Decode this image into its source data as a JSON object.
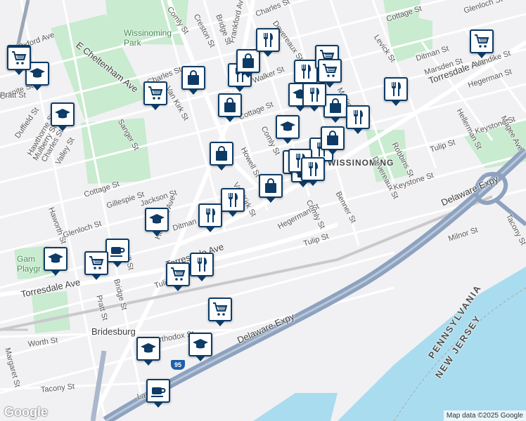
{
  "colors": {
    "background": "#f1f1f3",
    "park": "#c9ebd0",
    "water": "#a9dcef",
    "highway": "#8da2bf",
    "road": "#ffffff",
    "pin_border": "#0d3b66"
  },
  "labels": {
    "wissinoming_park": "Wissinoming\nPark",
    "gambrel_playground": "Gam\nPlaygr",
    "neighborhood": "WISSINOMING",
    "bridesburg": "Bridesburg",
    "pennsylvania": "PENNSYLVANIA",
    "new_jersey": "NEW JERSEY",
    "streets": {
      "oxford_ave": "Oxford Ave",
      "e_cheltenham_ave": "E Cheltenham Ave",
      "comly_st_top": "Comly St",
      "creston_st": "Creston St",
      "bridge_st_top": "Bridge St",
      "charles_st_top": "Charles St",
      "devereaux_st_top": "Devereaux St",
      "levick_st": "Levick St",
      "cottage_st_top": "Cottage St",
      "glenloch_st_top": "Glenloch St",
      "frankford_ave_top": "Frankford Ave",
      "marsden_st": "Marsden St",
      "ditman_st_top": "Ditman St",
      "torresdale_ave_right": "Torresdale Ave",
      "vandike_st": "Vandike St",
      "hegerman_st_right": "Hegerman St",
      "hellerman_st": "Hellerman St",
      "keystone_st_right": "Keystone St",
      "magee_ave": "Magee Ave",
      "tulip_st_right": "Tulip St",
      "robbins_st": "Robbins St",
      "devereaux_st_mid": "Devereaux St",
      "benner_st": "Benner St",
      "keystone_st_mid": "Keystone St",
      "delaware_expy_right": "Delaware Expy",
      "tacony_st_right": "Tacony St",
      "milnor_st": "Milnor St",
      "granite_st": "Granite St",
      "pratt_st_left": "Pratt St",
      "duffield_st": "Duffield St",
      "hawthorne_st": "Hawthorne St",
      "mulberry_st": "Mulberry St",
      "charles_st_left": "Charles St",
      "valley_st": "Valley St",
      "haworth_st": "Haworth St",
      "sanger_st": "Sanger St",
      "van_kirk_st_top": "Van Kirk St",
      "charles_st_mid": "Charles St",
      "cottage_st_mid": "Cottage St",
      "walker_st": "Walker St",
      "comly_st_mid": "Comly St",
      "howell_st": "Howell St",
      "van_kirk_st_mid": "Van Kirk St",
      "mckinley_st": "McKinley St",
      "cottage_st_left": "Cottage St",
      "gillespie_st": "Gillespie St",
      "jackson_st": "Jackson St",
      "ditman_st_left": "Ditman St",
      "glenloch_st_left": "Glenloch St",
      "brill_st": "Brill St",
      "harbison_ave": "Harbison Ave",
      "torresdale_ave_mid": "Torresdale Ave",
      "hegerman_st_mid": "Hegerman St",
      "comly_st_low": "Comly St",
      "tulip_st_mid": "Tulip St",
      "tulip_st_left": "Tulip St",
      "torresdale_ave_left": "Torresdale Ave",
      "pratt_st_low": "Pratt St",
      "bridge_st_low": "Bridge St",
      "margaret_st": "Margaret St",
      "worth_st": "Worth St",
      "orthodox_st": "Orthodox St",
      "delaware_expy_low": "Delaware Expy",
      "tacony_st_low": "Tacony St",
      "larue_st": "Larue St"
    },
    "shields": {
      "i95_low": "95"
    }
  },
  "pins": [
    {
      "type": "shopping-cart",
      "label": "grocery"
    },
    {
      "type": "graduation-cap",
      "label": "school"
    },
    {
      "type": "graduation-cap",
      "label": "school"
    },
    {
      "type": "shopping-cart",
      "label": "grocery"
    },
    {
      "type": "shopping-bag",
      "label": "store"
    },
    {
      "type": "fork-knife",
      "label": "restaurant"
    },
    {
      "type": "shopping-bag",
      "label": "store"
    },
    {
      "type": "fork-knife",
      "label": "restaurant"
    },
    {
      "type": "shopping-bag",
      "label": "store"
    },
    {
      "type": "fork-knife",
      "label": "restaurant"
    },
    {
      "type": "shopping-cart",
      "label": "grocery"
    },
    {
      "type": "fork-knife",
      "label": "restaurant"
    },
    {
      "type": "graduation-cap",
      "label": "school"
    },
    {
      "type": "shopping-bag",
      "label": "store"
    },
    {
      "type": "fork-knife",
      "label": "restaurant"
    },
    {
      "type": "fork-knife",
      "label": "restaurant"
    },
    {
      "type": "shopping-cart",
      "label": "grocery"
    },
    {
      "type": "graduation-cap",
      "label": "school"
    },
    {
      "type": "shopping-bag",
      "label": "store"
    },
    {
      "type": "fork-knife",
      "label": "restaurant"
    },
    {
      "type": "fork-knife",
      "label": "restaurant"
    },
    {
      "type": "shopping-bag",
      "label": "store"
    },
    {
      "type": "shopping-bag",
      "label": "store"
    },
    {
      "type": "shopping-bag",
      "label": "store"
    },
    {
      "type": "fork-knife",
      "label": "restaurant"
    },
    {
      "type": "fork-knife",
      "label": "restaurant"
    },
    {
      "type": "graduation-cap",
      "label": "school"
    },
    {
      "type": "coffee-cup",
      "label": "cafe"
    },
    {
      "type": "graduation-cap",
      "label": "school"
    },
    {
      "type": "shopping-cart",
      "label": "grocery"
    },
    {
      "type": "shopping-cart",
      "label": "grocery"
    },
    {
      "type": "fork-knife",
      "label": "restaurant"
    },
    {
      "type": "shopping-cart",
      "label": "grocery"
    },
    {
      "type": "graduation-cap",
      "label": "school"
    },
    {
      "type": "graduation-cap",
      "label": "school"
    },
    {
      "type": "coffee-cup",
      "label": "cafe"
    },
    {
      "type": "shopping-cart",
      "label": "grocery"
    },
    {
      "type": "shopping-cart",
      "label": "grocery"
    },
    {
      "type": "fork-knife",
      "label": "restaurant"
    },
    {
      "type": "fork-knife",
      "label": "restaurant"
    }
  ],
  "branding": {
    "logo": "Google",
    "attribution": "Map data ©2025 Google"
  }
}
